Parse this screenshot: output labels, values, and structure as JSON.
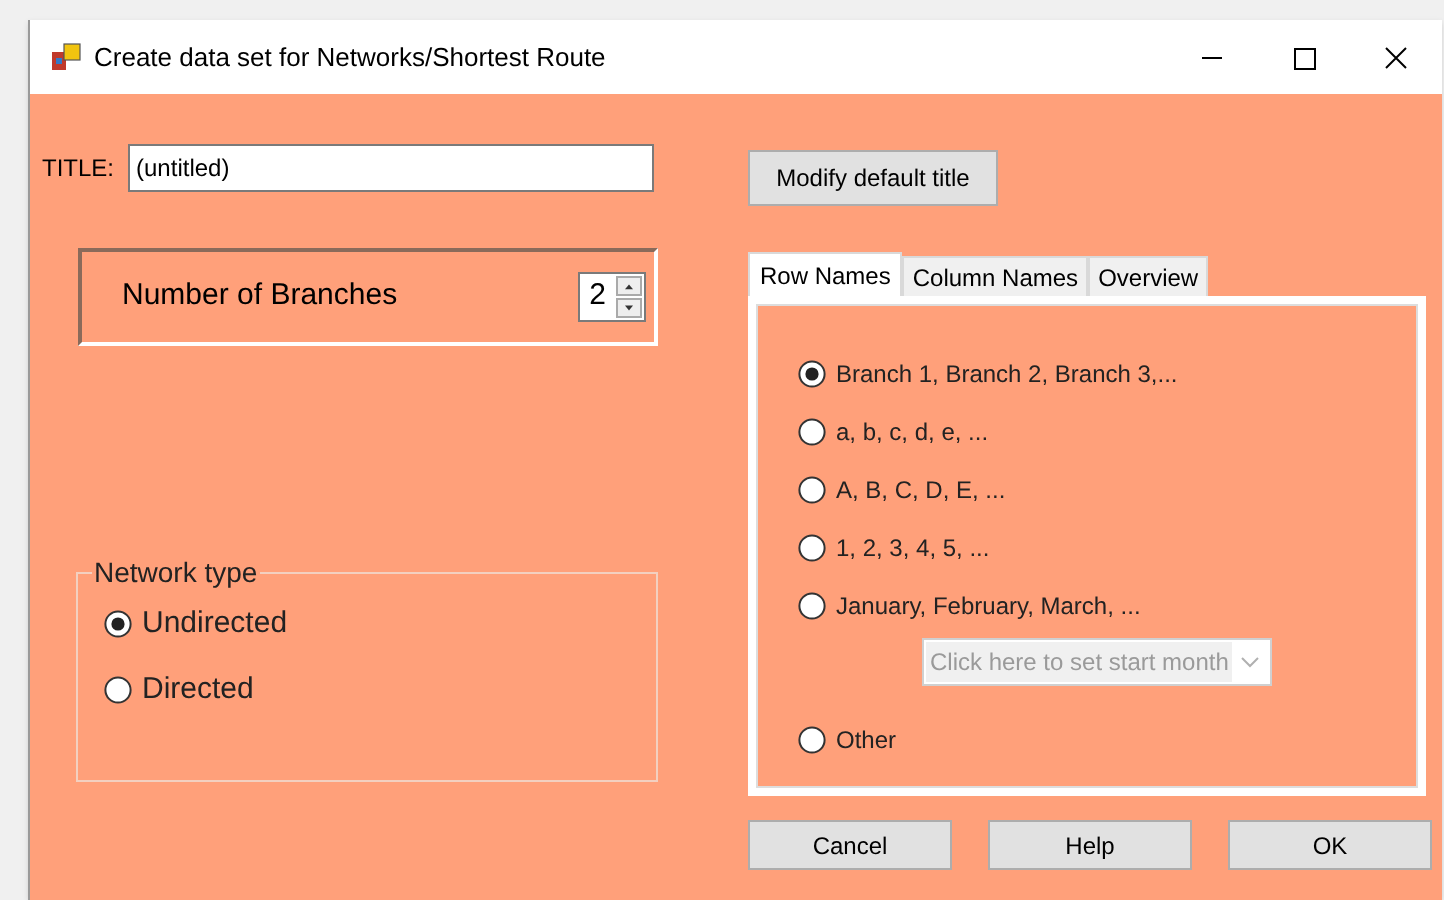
{
  "window": {
    "title": "Create data set for Networks/Shortest Route"
  },
  "title_field": {
    "label": "TITLE:",
    "value": "(untitled)"
  },
  "modify_button": "Modify default title",
  "branches": {
    "label": "Number of Branches",
    "value": "2"
  },
  "network_type": {
    "legend": "Network type",
    "options": [
      {
        "label": "Undirected",
        "selected": true
      },
      {
        "label": "Directed",
        "selected": false
      }
    ]
  },
  "tabs": [
    {
      "label": "Row Names",
      "selected": true
    },
    {
      "label": "Column Names",
      "selected": false
    },
    {
      "label": "Overview",
      "selected": false
    }
  ],
  "row_names": [
    {
      "label": "Branch 1, Branch 2, Branch 3,...",
      "selected": true
    },
    {
      "label": "a, b, c, d, e, ...",
      "selected": false
    },
    {
      "label": "A, B, C, D, E, ...",
      "selected": false
    },
    {
      "label": "1, 2, 3, 4, 5, ...",
      "selected": false
    },
    {
      "label": "January, February, March, ...",
      "selected": false
    }
  ],
  "start_month": {
    "placeholder": "Click here to set start month",
    "disabled": true
  },
  "other_option": {
    "label": "Other",
    "selected": false
  },
  "buttons": [
    "Cancel",
    "Help",
    "OK"
  ]
}
